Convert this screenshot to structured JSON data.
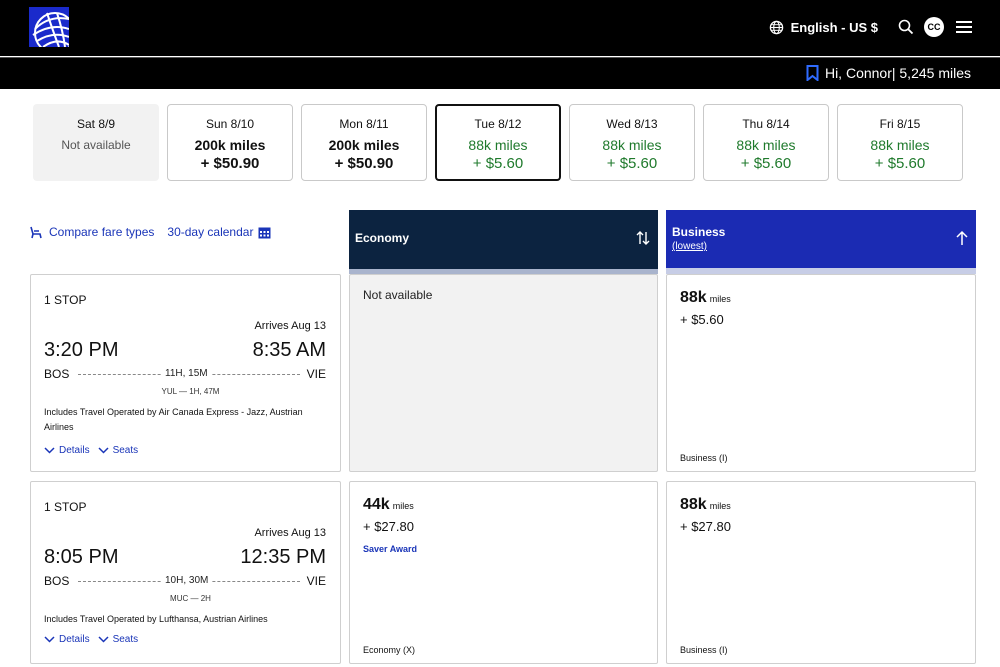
{
  "header": {
    "language": "English - US $",
    "avatar_initials": "CC",
    "greeting": "Hi, Connor| 5,245 miles",
    "brand_color": "#1a2acb"
  },
  "date_strip": [
    {
      "day": "Sat 8/9",
      "status": "Not available"
    },
    {
      "day": "Sun 8/10",
      "miles": "200k miles",
      "price": "+ $50.90"
    },
    {
      "day": "Mon 8/11",
      "miles": "200k miles",
      "price": "+ $50.90"
    },
    {
      "day": "Tue 8/12",
      "miles": "88k miles",
      "price": "+ $5.60",
      "selected": true
    },
    {
      "day": "Wed 8/13",
      "miles": "88k miles",
      "price": "+ $5.60"
    },
    {
      "day": "Thu 8/14",
      "miles": "88k miles",
      "price": "+ $5.60"
    },
    {
      "day": "Fri 8/15",
      "miles": "88k miles",
      "price": "+ $5.60"
    }
  ],
  "links": {
    "compare": "Compare fare types",
    "calendar": "30-day calendar"
  },
  "columns": {
    "economy": {
      "title": "Economy",
      "color": "#0c2340"
    },
    "business": {
      "title": "Business",
      "sub": "(lowest)",
      "color": "#1b2bb3"
    }
  },
  "flights": [
    {
      "stops": "1 STOP",
      "arrives": "Arrives Aug 13",
      "depart_time": "3:20 PM",
      "arrive_time": "8:35 AM",
      "origin": "BOS",
      "destination": "VIE",
      "duration": "11H, 15M",
      "layover": "YUL — 1H, 47M",
      "operated": "Includes Travel Operated by Air Canada Express - Jazz, Austrian Airlines",
      "details": "Details",
      "seats": "Seats",
      "economy": {
        "not_available": "Not available"
      },
      "business": {
        "miles": "88k",
        "unit": "miles",
        "tax": "+ $5.60",
        "cabin": "Business (I)"
      }
    },
    {
      "stops": "1 STOP",
      "arrives": "Arrives Aug 13",
      "depart_time": "8:05 PM",
      "arrive_time": "12:35 PM",
      "origin": "BOS",
      "destination": "VIE",
      "duration": "10H, 30M",
      "layover": "MUC — 2H",
      "operated": "Includes Travel Operated by Lufthansa, Austrian Airlines",
      "details": "Details",
      "seats": "Seats",
      "economy": {
        "miles": "44k",
        "unit": "miles",
        "tax": "+ $27.80",
        "award": "Saver Award",
        "cabin": "Economy (X)"
      },
      "business": {
        "miles": "88k",
        "unit": "miles",
        "tax": "+ $27.80",
        "cabin": "Business (I)"
      }
    }
  ]
}
